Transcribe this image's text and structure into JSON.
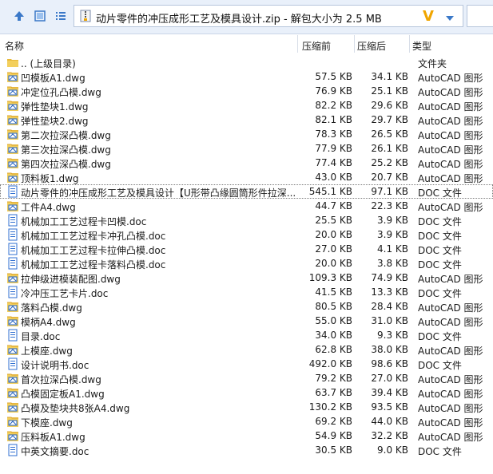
{
  "toolbar": {
    "path_title": "动片零件的冲压成形工艺及模具设计.zip - 解包大小为 2.5 MB",
    "icons": [
      "up-arrow-icon",
      "details-view-icon",
      "list-view-icon",
      "zip-file-icon",
      "brand-v-logo",
      "chevron-down-icon"
    ],
    "brand_letter": "V"
  },
  "columns": {
    "name": "名称",
    "compressed": "压缩前",
    "after": "压缩后",
    "type": "类型"
  },
  "files": [
    {
      "name": ".. (上级目录)",
      "size": "",
      "comp": "",
      "type": "文件夹",
      "icon": "folder"
    },
    {
      "name": "凹模板A1.dwg",
      "size": "57.5 KB",
      "comp": "34.1 KB",
      "type": "AutoCAD 图形",
      "icon": "dwg"
    },
    {
      "name": "冲定位孔凸模.dwg",
      "size": "76.9 KB",
      "comp": "25.1 KB",
      "type": "AutoCAD 图形",
      "icon": "dwg"
    },
    {
      "name": "弹性垫块1.dwg",
      "size": "82.2 KB",
      "comp": "29.6 KB",
      "type": "AutoCAD 图形",
      "icon": "dwg"
    },
    {
      "name": "弹性垫块2.dwg",
      "size": "82.1 KB",
      "comp": "29.7 KB",
      "type": "AutoCAD 图形",
      "icon": "dwg"
    },
    {
      "name": "第二次拉深凸模.dwg",
      "size": "78.3 KB",
      "comp": "26.5 KB",
      "type": "AutoCAD 图形",
      "icon": "dwg"
    },
    {
      "name": "第三次拉深凸模.dwg",
      "size": "77.9 KB",
      "comp": "26.1 KB",
      "type": "AutoCAD 图形",
      "icon": "dwg"
    },
    {
      "name": "第四次拉深凸模.dwg",
      "size": "77.4 KB",
      "comp": "25.2 KB",
      "type": "AutoCAD 图形",
      "icon": "dwg"
    },
    {
      "name": "顶料板1.dwg",
      "size": "43.0 KB",
      "comp": "20.7 KB",
      "type": "AutoCAD 图形",
      "icon": "dwg"
    },
    {
      "name": "动片零件的冲压成形工艺及模具设计【U形带凸缘圆筒形件拉深...",
      "size": "545.1 KB",
      "comp": "97.1 KB",
      "type": "DOC 文件",
      "icon": "doc",
      "selected": true
    },
    {
      "name": "工件A4.dwg",
      "size": "44.7 KB",
      "comp": "22.3 KB",
      "type": "AutoCAD 图形",
      "icon": "dwg"
    },
    {
      "name": "机械加工工艺过程卡凹模.doc",
      "size": "25.5 KB",
      "comp": "3.9 KB",
      "type": "DOC 文件",
      "icon": "doc"
    },
    {
      "name": "机械加工工艺过程卡冲孔凸模.doc",
      "size": "20.0 KB",
      "comp": "3.9 KB",
      "type": "DOC 文件",
      "icon": "doc"
    },
    {
      "name": "机械加工工艺过程卡拉伸凸模.doc",
      "size": "27.0 KB",
      "comp": "4.1 KB",
      "type": "DOC 文件",
      "icon": "doc"
    },
    {
      "name": "机械加工工艺过程卡落料凸模.doc",
      "size": "20.0 KB",
      "comp": "3.8 KB",
      "type": "DOC 文件",
      "icon": "doc"
    },
    {
      "name": "拉伸级进模装配图.dwg",
      "size": "109.3 KB",
      "comp": "74.9 KB",
      "type": "AutoCAD 图形",
      "icon": "dwg"
    },
    {
      "name": "冷冲压工艺卡片.doc",
      "size": "41.5 KB",
      "comp": "13.3 KB",
      "type": "DOC 文件",
      "icon": "doc"
    },
    {
      "name": "落料凸模.dwg",
      "size": "80.5 KB",
      "comp": "28.4 KB",
      "type": "AutoCAD 图形",
      "icon": "dwg"
    },
    {
      "name": "模柄A4.dwg",
      "size": "55.0 KB",
      "comp": "31.0 KB",
      "type": "AutoCAD 图形",
      "icon": "dwg"
    },
    {
      "name": "目录.doc",
      "size": "34.0 KB",
      "comp": "9.3 KB",
      "type": "DOC 文件",
      "icon": "doc"
    },
    {
      "name": "上模座.dwg",
      "size": "62.8 KB",
      "comp": "38.0 KB",
      "type": "AutoCAD 图形",
      "icon": "dwg"
    },
    {
      "name": "设计说明书.doc",
      "size": "492.0 KB",
      "comp": "98.6 KB",
      "type": "DOC 文件",
      "icon": "doc"
    },
    {
      "name": "首次拉深凸模.dwg",
      "size": "79.2 KB",
      "comp": "27.0 KB",
      "type": "AutoCAD 图形",
      "icon": "dwg"
    },
    {
      "name": "凸模固定板A1.dwg",
      "size": "63.7 KB",
      "comp": "39.4 KB",
      "type": "AutoCAD 图形",
      "icon": "dwg"
    },
    {
      "name": "凸模及垫块共8张A4.dwg",
      "size": "130.2 KB",
      "comp": "93.5 KB",
      "type": "AutoCAD 图形",
      "icon": "dwg"
    },
    {
      "name": "下模座.dwg",
      "size": "69.2 KB",
      "comp": "44.0 KB",
      "type": "AutoCAD 图形",
      "icon": "dwg"
    },
    {
      "name": "压料板A1.dwg",
      "size": "54.9 KB",
      "comp": "32.2 KB",
      "type": "AutoCAD 图形",
      "icon": "dwg"
    },
    {
      "name": "中英文摘要.doc",
      "size": "30.5 KB",
      "comp": "9.0 KB",
      "type": "DOC 文件",
      "icon": "doc"
    }
  ],
  "colors": {
    "toolbar_bg": "#e9f0fa",
    "folder": "#e8b93a",
    "dwg_accent": "#1f5fbf",
    "doc_accent": "#2f6fd1",
    "brand": "#f0a500"
  }
}
